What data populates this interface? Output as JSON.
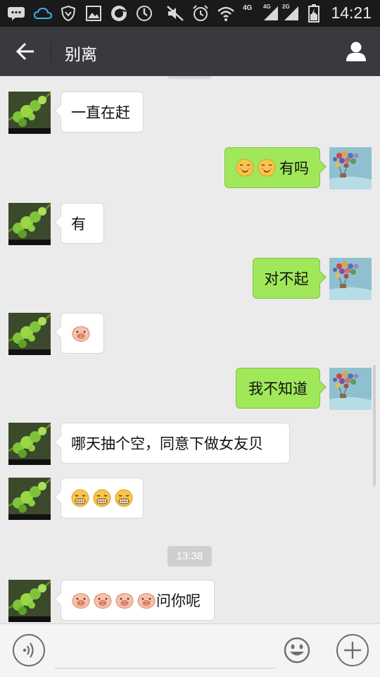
{
  "status_bar": {
    "time": "14:21",
    "network_labels": [
      "4G",
      "4G",
      "2G"
    ],
    "icons": [
      "message-icon",
      "cloud-icon",
      "shield-icon",
      "image-icon",
      "browser-icon",
      "sync-icon",
      "mute-icon",
      "alarm-icon",
      "wifi-icon",
      "signal-icon",
      "signal-icon",
      "signal-icon",
      "battery-icon"
    ]
  },
  "title_bar": {
    "title": "别离",
    "back_icon": "back-arrow-icon",
    "profile_icon": "person-icon"
  },
  "messages": [
    {
      "side": "in",
      "text": "一直在赶",
      "emojis": []
    },
    {
      "side": "out",
      "text": "有吗",
      "emojis": [
        "blush",
        "blush"
      ]
    },
    {
      "side": "in",
      "text": "有",
      "emojis": []
    },
    {
      "side": "out",
      "text": "对不起",
      "emojis": []
    },
    {
      "side": "in",
      "text": "",
      "emojis": [
        "pig"
      ]
    },
    {
      "side": "out",
      "text": "我不知道",
      "emojis": []
    },
    {
      "side": "in",
      "text": "哪天抽个空，同意下做女友贝",
      "emojis": []
    },
    {
      "side": "in",
      "text": "",
      "emojis": [
        "grin",
        "grin",
        "grin"
      ]
    },
    {
      "side": "in",
      "text": "问你呢",
      "emojis": [
        "pig",
        "pig",
        "pig",
        "pig"
      ]
    }
  ],
  "timestamp": "13:38",
  "input_bar": {
    "placeholder": "",
    "voice_icon": "voice-icon",
    "emoji_icon": "smiley-icon",
    "plus_icon": "plus-icon"
  },
  "colors": {
    "title_bar": "#393a3f",
    "chat_bg": "#ebebeb",
    "outgoing_bubble": "#a0e75a",
    "incoming_bubble": "#ffffff"
  }
}
